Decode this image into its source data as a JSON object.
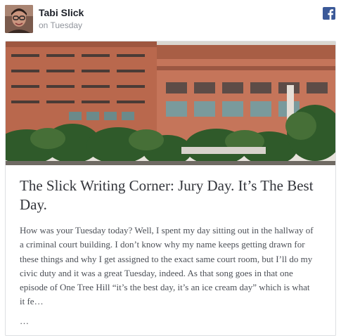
{
  "post": {
    "author_name": "Tabi Slick",
    "timestamp": "on Tuesday",
    "platform_icon": "facebook-icon",
    "avatar_icon": "profile-photo-woman-with-glasses"
  },
  "link_card": {
    "image_description_icon": "courthouse-building-photo",
    "title": "The Slick Writing Corner: Jury Day. It’s The Best Day.",
    "excerpt": "How was your Tuesday today? Well, I spent my day sitting out in the hallway of a criminal court building. I don’t know why my name keeps getting drawn for these things and why I get assigned to the exact same court room, but I’ll do my civic duty and it was a great Tuesday, indeed. As that song goes in that one episode of One Tree Hill “it’s the best day, it’s an ice cream day” which is what it fe…",
    "more": "…"
  },
  "colors": {
    "facebook_blue": "#3b5998",
    "author_text": "#1d2129",
    "meta_text": "#90949c",
    "title_text": "#33353b",
    "body_text": "#4b4f56",
    "card_border": "#dddfe2"
  }
}
